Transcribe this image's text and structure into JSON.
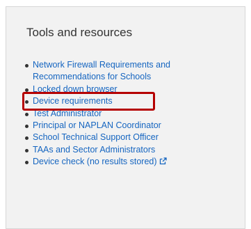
{
  "panel": {
    "title": "Tools and resources",
    "links": [
      {
        "line1": "Network Firewall Requirements and",
        "line2": "Recommendations for Schools"
      },
      {
        "label": "Locked down browser",
        "highlighted": true
      },
      {
        "label": "Device requirements"
      },
      {
        "label": "Test Administrator"
      },
      {
        "label": "Principal or NAPLAN Coordinator"
      },
      {
        "label": "School Technical Support Officer"
      },
      {
        "label": "TAAs and Sector Administrators"
      },
      {
        "label": "Device check (no results stored)",
        "icon": "external-link-icon"
      }
    ]
  },
  "colors": {
    "link": "#1565c0",
    "highlight": "#b50000",
    "panel_bg": "#f2f2f2"
  }
}
